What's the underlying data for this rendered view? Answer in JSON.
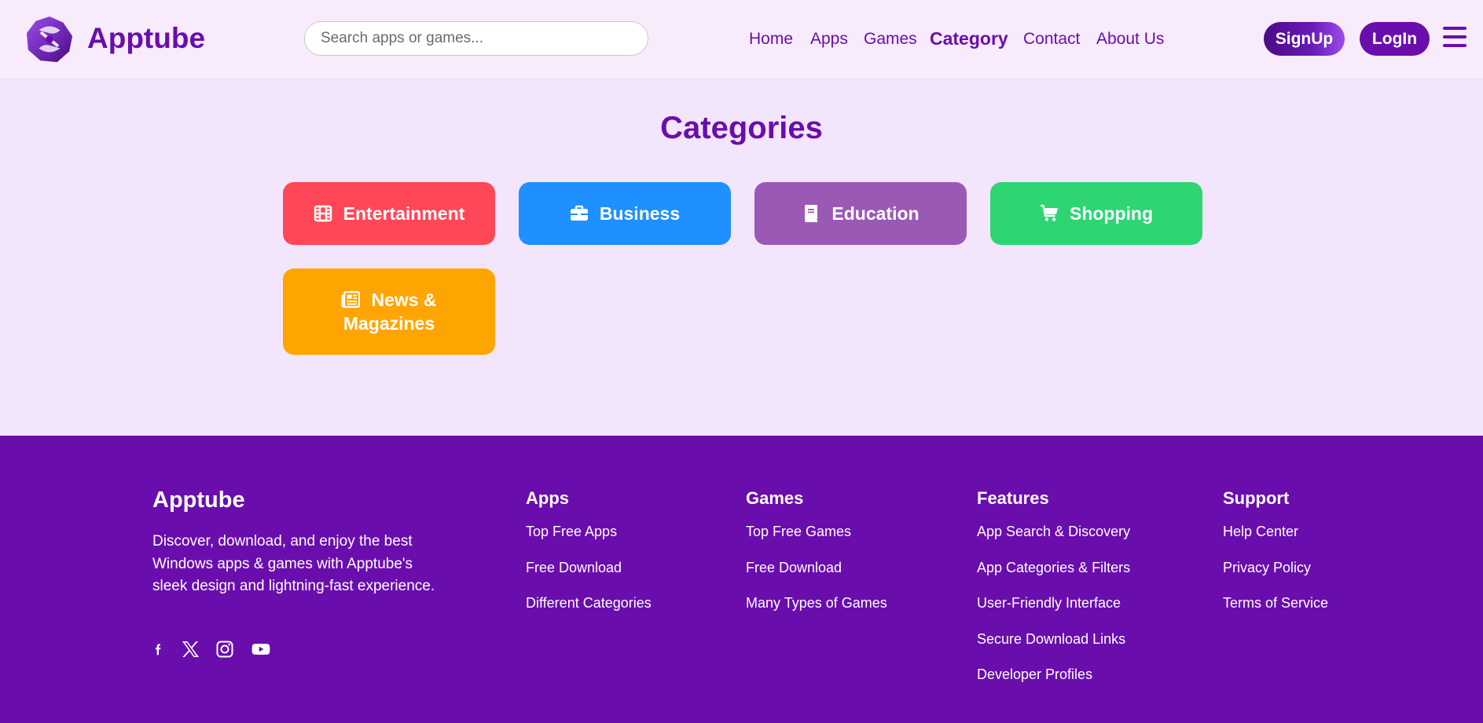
{
  "brand": {
    "name": "Apptube",
    "icon": "apptube-logo-icon"
  },
  "search": {
    "placeholder": "Search apps or games..."
  },
  "nav": [
    {
      "label": "Home"
    },
    {
      "label": "Apps"
    },
    {
      "label": "Games"
    },
    {
      "label": "Category",
      "active": true
    },
    {
      "label": "Contact"
    },
    {
      "label": "About Us"
    }
  ],
  "auth": {
    "signup": "SignUp",
    "login": "LogIn"
  },
  "menu_icon": "hamburger-menu-icon",
  "page_title": "Categories",
  "categories": [
    {
      "label": "Entertainment",
      "icon": "film-icon",
      "color": "#ff4757"
    },
    {
      "label": "Business",
      "icon": "briefcase-icon",
      "color": "#1e90ff"
    },
    {
      "label": "Education",
      "icon": "book-icon",
      "color": "#9b59b6"
    },
    {
      "label": "Shopping",
      "icon": "cart-icon",
      "color": "#2ed573"
    },
    {
      "label_line1": "News &",
      "label_line2": "Magazines",
      "icon": "newspaper-icon",
      "color": "#ffa502"
    }
  ],
  "footer": {
    "brand": "Apptube",
    "description": "Discover, download, and enjoy the best Windows apps & games with Apptube's sleek design and lightning-fast experience.",
    "socials": [
      "facebook-icon",
      "x-twitter-icon",
      "instagram-icon",
      "youtube-icon"
    ],
    "columns": [
      {
        "title": "Apps",
        "links": [
          "Top Free Apps",
          "Free Download",
          "Different Categories"
        ]
      },
      {
        "title": "Games",
        "links": [
          "Top Free Games",
          "Free Download",
          "Many Types of Games"
        ]
      },
      {
        "title": "Features",
        "links": [
          "App Search & Discovery",
          "App Categories & Filters",
          "User-Friendly Interface",
          "Secure Download Links",
          "Developer Profiles"
        ]
      },
      {
        "title": "Support",
        "links": [
          "Help Center",
          "Privacy Policy",
          "Terms of Service"
        ]
      }
    ]
  },
  "colors": {
    "primary": "#6a0dad",
    "background": "#f3e5fb",
    "header_bg": "#f8ecfc"
  }
}
